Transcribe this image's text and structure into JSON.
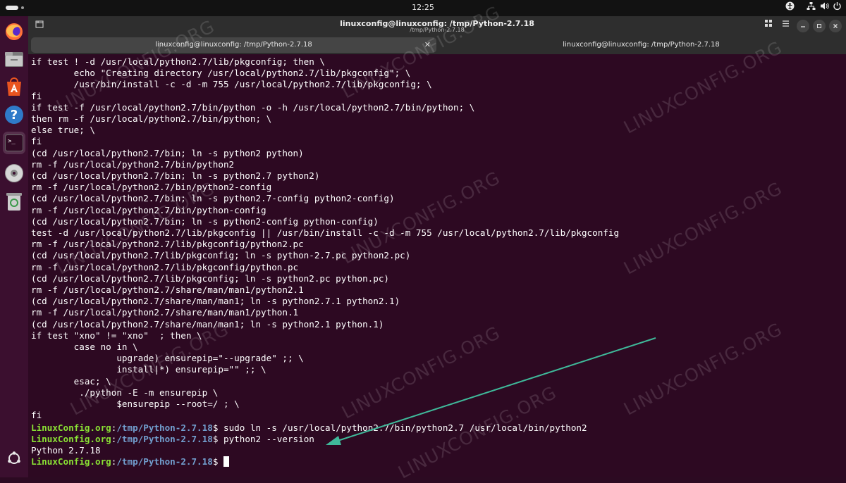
{
  "topbar": {
    "clock": "12:25"
  },
  "window": {
    "title": "linuxconfig@linuxconfig: /tmp/Python-2.7.18",
    "subtitle": "/tmp/Python-2.7.18"
  },
  "tabs": [
    {
      "label": "linuxconfig@linuxconfig: /tmp/Python-2.7.18",
      "close": "✕"
    },
    {
      "label": "linuxconfig@linuxconfig: /tmp/Python-2.7.18"
    }
  ],
  "dock": [
    "firefox-icon",
    "files-icon",
    "app-center-icon",
    "help-icon",
    "terminal-icon",
    "disc-icon",
    "trash-icon",
    "show-apps-icon"
  ],
  "terminal": {
    "output_lines": [
      "if test ! -d /usr/local/python2.7/lib/pkgconfig; then \\",
      "        echo \"Creating directory /usr/local/python2.7/lib/pkgconfig\"; \\",
      "        /usr/bin/install -c -d -m 755 /usr/local/python2.7/lib/pkgconfig; \\",
      "fi",
      "if test -f /usr/local/python2.7/bin/python -o -h /usr/local/python2.7/bin/python; \\",
      "then rm -f /usr/local/python2.7/bin/python; \\",
      "else true; \\",
      "fi",
      "(cd /usr/local/python2.7/bin; ln -s python2 python)",
      "rm -f /usr/local/python2.7/bin/python2",
      "(cd /usr/local/python2.7/bin; ln -s python2.7 python2)",
      "rm -f /usr/local/python2.7/bin/python2-config",
      "(cd /usr/local/python2.7/bin; ln -s python2.7-config python2-config)",
      "rm -f /usr/local/python2.7/bin/python-config",
      "(cd /usr/local/python2.7/bin; ln -s python2-config python-config)",
      "test -d /usr/local/python2.7/lib/pkgconfig || /usr/bin/install -c -d -m 755 /usr/local/python2.7/lib/pkgconfig",
      "rm -f /usr/local/python2.7/lib/pkgconfig/python2.pc",
      "(cd /usr/local/python2.7/lib/pkgconfig; ln -s python-2.7.pc python2.pc)",
      "rm -f /usr/local/python2.7/lib/pkgconfig/python.pc",
      "(cd /usr/local/python2.7/lib/pkgconfig; ln -s python2.pc python.pc)",
      "rm -f /usr/local/python2.7/share/man/man1/python2.1",
      "(cd /usr/local/python2.7/share/man/man1; ln -s python2.7.1 python2.1)",
      "rm -f /usr/local/python2.7/share/man/man1/python.1",
      "(cd /usr/local/python2.7/share/man/man1; ln -s python2.1 python.1)",
      "if test \"xno\" != \"xno\"  ; then \\",
      "        case no in \\",
      "                upgrade) ensurepip=\"--upgrade\" ;; \\",
      "                install|*) ensurepip=\"\" ;; \\",
      "        esac; \\",
      "         ./python -E -m ensurepip \\",
      "                $ensurepip --root=/ ; \\",
      "fi"
    ],
    "prompt_user": "LinuxConfig.org",
    "prompt_sep": ":",
    "prompt_path": "/tmp/Python-2.7.18",
    "prompt_dollar": "$ ",
    "cmd1": "sudo ln -s /usr/local/python2.7/bin/python2.7 /usr/local/bin/python2",
    "cmd2": "python2 --version",
    "version_output": "Python 2.7.18"
  },
  "watermark": "LINUXCONFIG.ORG",
  "annotation": {
    "arrow_color": "#3fb99a"
  }
}
